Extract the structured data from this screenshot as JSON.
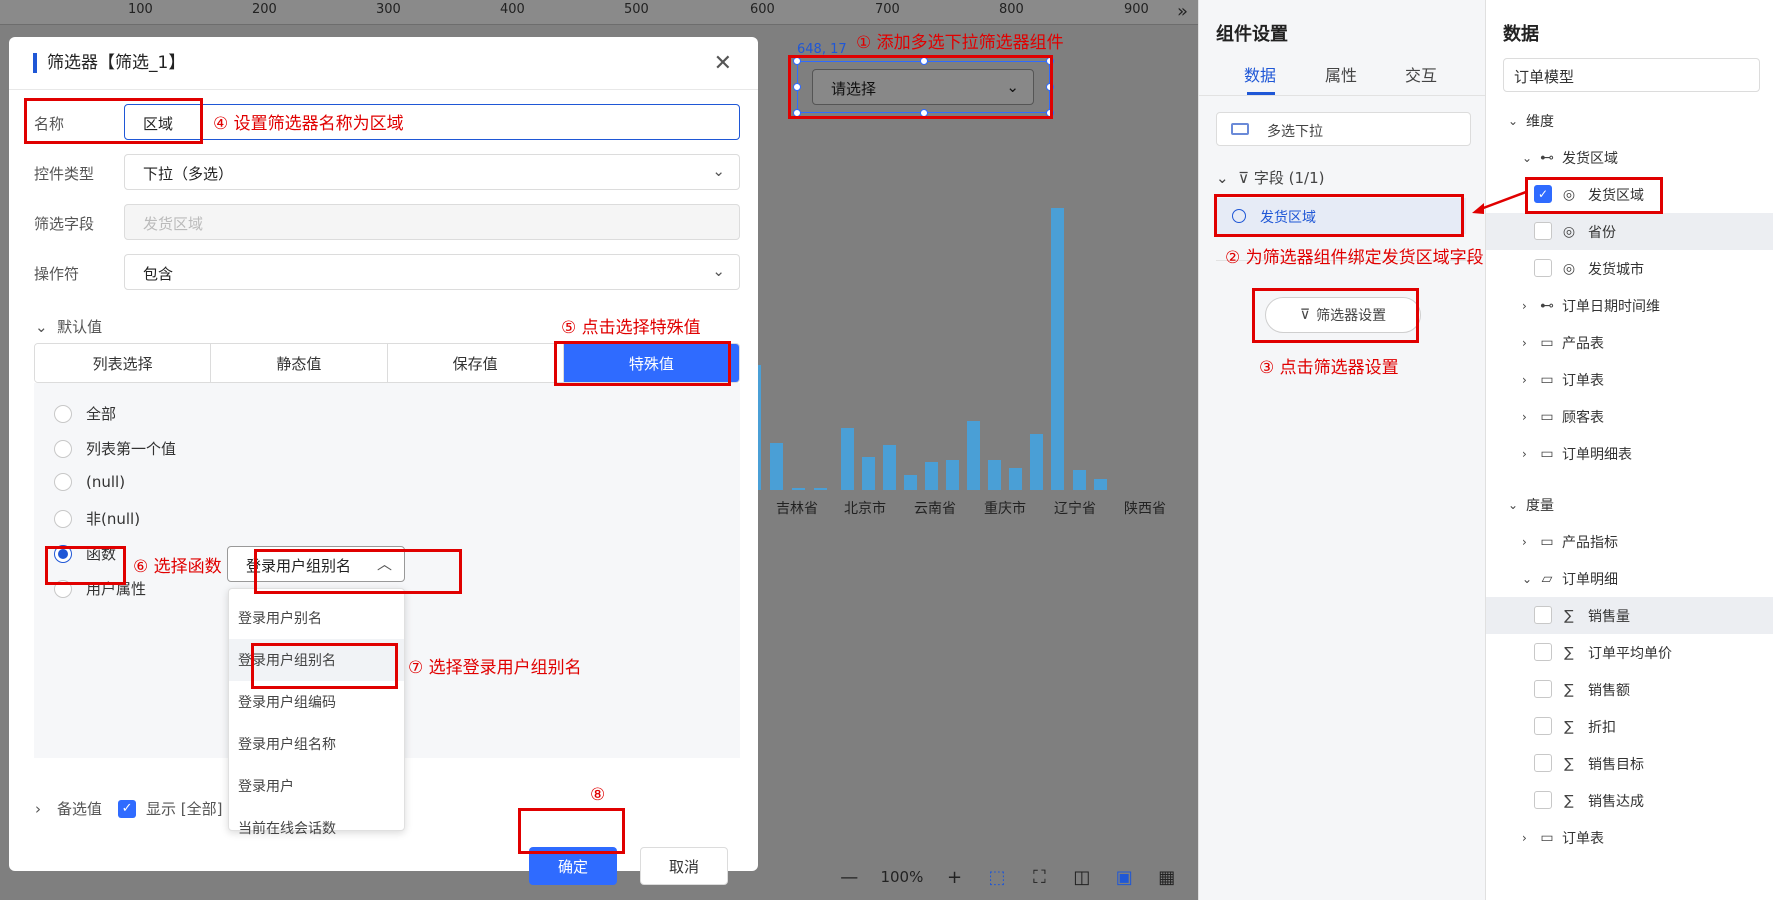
{
  "ruler": {
    "labels": [
      "100",
      "200",
      "300",
      "400",
      "500",
      "600",
      "700",
      "800",
      "900"
    ],
    "collapse_glyph": "»"
  },
  "canvas": {
    "widget_position": "648, 17",
    "widget_placeholder": "请选择",
    "chart_categories": [
      "吉林省",
      "北京市",
      "云南省",
      "重庆市",
      "辽宁省",
      "陕西省"
    ],
    "zoom": "100%"
  },
  "dialog": {
    "title": "筛选器【筛选_1】",
    "name_label": "名称",
    "name_value": "区域",
    "type_label": "控件类型",
    "type_value": "下拉（多选）",
    "field_label": "筛选字段",
    "field_value": "发货区域",
    "operator_label": "操作符",
    "operator_value": "包含",
    "default_label": "默认值",
    "tabs": [
      "列表选择",
      "静态值",
      "保存值",
      "特殊值"
    ],
    "radios": [
      "全部",
      "列表第一个值",
      "(null)",
      "非(null)",
      "函数",
      "用户属性"
    ],
    "function_value": "登录用户组别名",
    "function_options": [
      "登录用户别名",
      "登录用户组别名",
      "登录用户组编码",
      "登录用户组名称",
      "登录用户",
      "当前在线会话数"
    ],
    "backup_label": "备选值",
    "show_all_label": "显示 [全部]",
    "ok_label": "确定",
    "cancel_label": "取消"
  },
  "annotations": {
    "a1": "① 添加多选下拉筛选器组件",
    "a2": "② 为筛选器组件绑定发货区域字段",
    "a3": "③ 点击筛选器设置",
    "a4": "④ 设置筛选器名称为区域",
    "a5": "⑤ 点击选择特殊值",
    "a6": "⑥ 选择函数",
    "a7": "⑦ 选择登录用户组别名",
    "a8": "⑧"
  },
  "settings": {
    "title": "组件设置",
    "tabs": [
      "数据",
      "属性",
      "交互"
    ],
    "widget_type": "多选下拉",
    "fields_header": "字段 (1/1)",
    "bound_field": "发货区域",
    "filter_settings_button": "筛选器设置"
  },
  "data_panel": {
    "title": "数据",
    "model": "订单模型",
    "dimensions_label": "维度",
    "dim_group": "发货区域",
    "dim_fields": [
      "发货区域",
      "省份",
      "发货城市"
    ],
    "dim_folders": [
      "订单日期时间维",
      "产品表",
      "订单表",
      "顾客表",
      "订单明细表"
    ],
    "measures_label": "度量",
    "measure_folders": [
      "产品指标",
      "订单明细"
    ],
    "measure_fields": [
      "销售量",
      "订单平均单价",
      "销售额",
      "折扣",
      "销售目标",
      "销售达成"
    ],
    "last_folder": "订单表"
  },
  "colors": {
    "accent": "#2f6bff",
    "annotation": "#e00000",
    "bar": "#4a9fd6"
  }
}
